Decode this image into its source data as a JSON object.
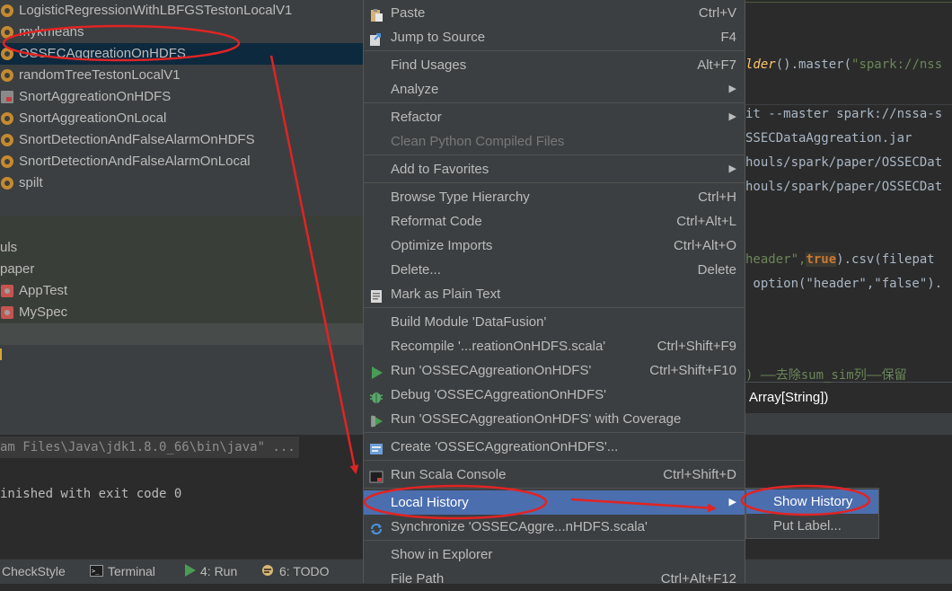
{
  "tree": {
    "items": [
      {
        "label": "LogisticRegressionWithLBFGSTestonLocalV1",
        "icon": "scala-object-icon"
      },
      {
        "label": "mykmeans",
        "icon": "scala-object-icon"
      },
      {
        "label": "OSSECAggreationOnHDFS",
        "icon": "scala-object-icon",
        "selected": true
      },
      {
        "label": "randomTreeTestonLocalV1",
        "icon": "scala-object-icon"
      },
      {
        "label": "SnortAggreationOnHDFS",
        "icon": "scala-file-icon"
      },
      {
        "label": "SnortAggreationOnLocal",
        "icon": "scala-object-icon"
      },
      {
        "label": "SnortDetectionAndFalseAlarmOnHDFS",
        "icon": "scala-object-icon"
      },
      {
        "label": "SnortDetectionAndFalseAlarmOnLocal",
        "icon": "scala-object-icon"
      },
      {
        "label": "spilt",
        "icon": "scala-object-icon"
      }
    ],
    "folders": [
      "uls",
      "paper"
    ],
    "tests": [
      "AppTest",
      "MySpec"
    ]
  },
  "editor": {
    "l1_fn": "lder",
    "l1_rest": "().master(",
    "l1_str": "\"spark://nss",
    "l2": "it --master spark://nssa-s",
    "l3": "SSECDataAggreation.jar",
    "l4": "houls/spark/paper/OSSECDat",
    "l5": "houls/spark/paper/OSSECDat",
    "l6_a": "header\",",
    "l6_kw": "true",
    "l6_b": ").csv(filepat",
    "l7": " option(\"header\",\"false\").",
    "l8": ") ——去除sum_sim列——保留",
    "l9": "Array[String])"
  },
  "run": {
    "cmd": "am Files\\Java\\jdk1.8.0_66\\bin\\java\" ...",
    "exit": "inished with exit code 0"
  },
  "status": {
    "tabs": [
      {
        "label": "CheckStyle",
        "icon": "checkstyle-icon"
      },
      {
        "label": "Terminal",
        "icon": "terminal-icon"
      },
      {
        "label": "4: Run",
        "icon": "run-icon"
      },
      {
        "label": "6: TODO",
        "icon": "todo-icon"
      }
    ]
  },
  "menu": {
    "items": [
      {
        "label": "Paste",
        "shortcut": "Ctrl+V",
        "icon": "paste-icon"
      },
      {
        "label": "Jump to Source",
        "shortcut": "F4",
        "icon": "jump-to-source-icon"
      },
      {
        "label": "Find Usages",
        "shortcut": "Alt+F7"
      },
      {
        "label": "Analyze",
        "submenu": true
      },
      {
        "label": "Refactor",
        "submenu": true
      },
      {
        "label": "Clean Python Compiled Files",
        "disabled": true
      },
      {
        "label": "Add to Favorites",
        "submenu": true
      },
      {
        "label": "Browse Type Hierarchy",
        "shortcut": "Ctrl+H"
      },
      {
        "label": "Reformat Code",
        "shortcut": "Ctrl+Alt+L"
      },
      {
        "label": "Optimize Imports",
        "shortcut": "Ctrl+Alt+O"
      },
      {
        "label": "Delete...",
        "shortcut": "Delete"
      },
      {
        "label": "Mark as Plain Text",
        "icon": "plain-text-icon"
      },
      {
        "label": "Build Module 'DataFusion'"
      },
      {
        "label": "Recompile '...reationOnHDFS.scala'",
        "shortcut": "Ctrl+Shift+F9"
      },
      {
        "label": "Run 'OSSECAggreationOnHDFS'",
        "shortcut": "Ctrl+Shift+F10",
        "icon": "run-icon"
      },
      {
        "label": "Debug 'OSSECAggreationOnHDFS'",
        "icon": "debug-icon"
      },
      {
        "label": "Run 'OSSECAggreationOnHDFS' with Coverage",
        "icon": "coverage-icon"
      },
      {
        "label": "Create 'OSSECAggreationOnHDFS'...",
        "icon": "run-config-icon"
      },
      {
        "label": "Run Scala Console",
        "shortcut": "Ctrl+Shift+D",
        "icon": "console-icon"
      },
      {
        "label": "Local History",
        "submenu": true,
        "active": true
      },
      {
        "label": "Synchronize 'OSSECAggre...nHDFS.scala'",
        "icon": "sync-icon"
      },
      {
        "label": "Show in Explorer"
      },
      {
        "label": "File Path",
        "shortcut": "Ctrl+Alt+F12"
      }
    ]
  },
  "submenu": {
    "items": [
      {
        "label": "Show History",
        "active": true
      },
      {
        "label": "Put Label..."
      }
    ]
  },
  "colors": {
    "accent": "#4b6eaf",
    "annotation": "#e02424",
    "menu_bg": "#3c3f41",
    "selection": "#0d293e"
  }
}
